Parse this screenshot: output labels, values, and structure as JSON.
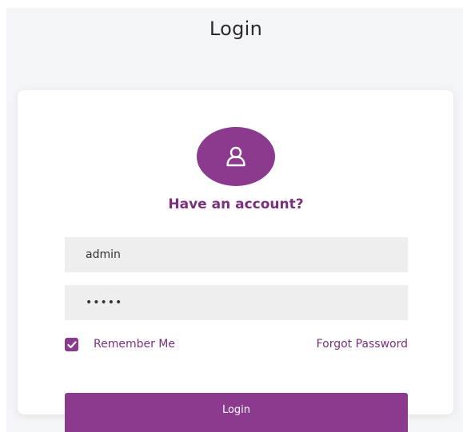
{
  "header": {
    "title": "Login"
  },
  "form": {
    "subtitle": "Have an account?",
    "avatar_icon": "user-icon",
    "username_value": "admin",
    "password_value": "•••••",
    "remember_label": "Remember Me",
    "remember_checked": true,
    "forgot_label": "Forgot Password",
    "submit_label": "Login"
  },
  "colors": {
    "accent": "#8b3a8e",
    "accent_text": "#7a2f7e",
    "page_background": "#f3f5f9",
    "input_background": "#eeeeee"
  }
}
